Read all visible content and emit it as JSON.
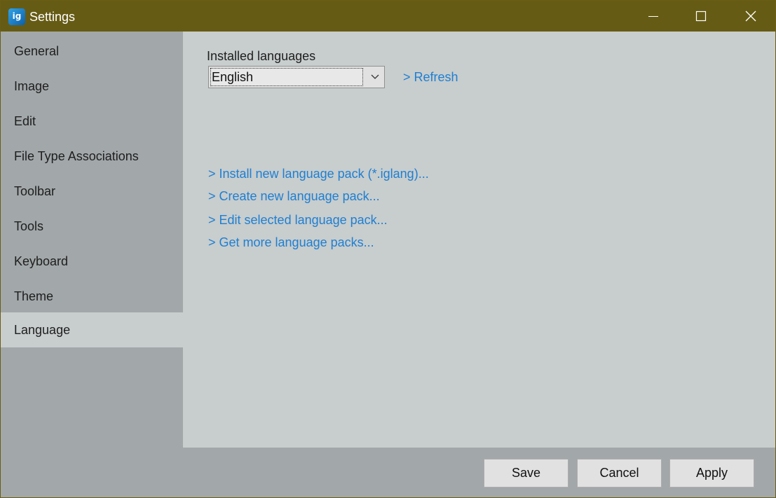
{
  "window": {
    "title": "Settings",
    "app_icon_glyph": "ig",
    "colors": {
      "titlebar": "#665b14",
      "sidebar": "#a2a7a9",
      "content": "#c8cdcd",
      "link": "#1e7fd2"
    }
  },
  "sidebar": {
    "items": [
      {
        "label": "General"
      },
      {
        "label": "Image"
      },
      {
        "label": "Edit"
      },
      {
        "label": "File Type Associations"
      },
      {
        "label": "Toolbar"
      },
      {
        "label": "Tools"
      },
      {
        "label": "Keyboard"
      },
      {
        "label": "Theme"
      },
      {
        "label": "Language",
        "selected": true
      }
    ]
  },
  "content": {
    "installed_label": "Installed languages",
    "language_select": {
      "value": "English",
      "icon": "chevron-down-icon"
    },
    "refresh_link": "> Refresh",
    "links": {
      "install": "> Install new language pack (*.iglang)...",
      "create": "> Create new language pack...",
      "edit": "> Edit selected language pack...",
      "more": "> Get more language packs..."
    }
  },
  "footer": {
    "save": "Save",
    "cancel": "Cancel",
    "apply": "Apply"
  }
}
